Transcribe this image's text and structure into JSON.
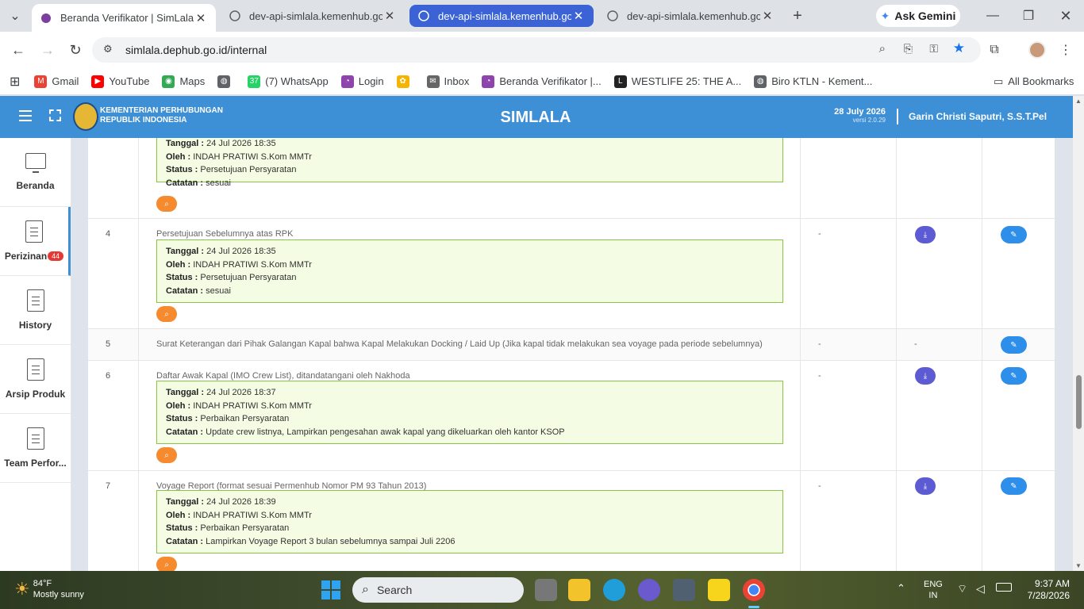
{
  "browser": {
    "tabs": [
      {
        "title": "Beranda Verifikator | SimLala",
        "active": true
      },
      {
        "title": "dev-api-simlala.kemenhub.go.id",
        "active": false
      },
      {
        "title": "dev-api-simlala.kemenhub.go.id",
        "active": false,
        "highlighted": true
      },
      {
        "title": "dev-api-simlala.kemenhub.go.id",
        "active": false
      }
    ],
    "new_tab": "+",
    "ask_gemini": "Ask Gemini",
    "url": "simlala.dephub.go.id/internal",
    "bookmarks": [
      {
        "label": "Gmail",
        "color": "#ea4335",
        "glyph": "M"
      },
      {
        "label": "YouTube",
        "color": "#ff0000",
        "glyph": "▶"
      },
      {
        "label": "Maps",
        "color": "#34a853",
        "glyph": "◉"
      },
      {
        "label": "",
        "color": "#5f6368",
        "glyph": "◍"
      },
      {
        "label": "(7) WhatsApp",
        "color": "#25d366",
        "glyph": "37"
      },
      {
        "label": "Login",
        "color": "#8e44ad",
        "glyph": "◔"
      },
      {
        "label": "",
        "color": "#f4b400",
        "glyph": "✿"
      },
      {
        "label": "Inbox",
        "color": "#666",
        "glyph": "✉"
      },
      {
        "label": "Beranda Verifikator |...",
        "color": "#8e44ad",
        "glyph": "◔"
      },
      {
        "label": "WESTLIFE 25: THE A...",
        "color": "#222",
        "glyph": "L"
      },
      {
        "label": "Biro KTLN - Kement...",
        "color": "#5f6368",
        "glyph": "◍"
      }
    ],
    "all_bookmarks": "All Bookmarks"
  },
  "app": {
    "ministry_line1": "KEMENTERIAN PERHUBUNGAN",
    "ministry_line2": "REPUBLIK INDONESIA",
    "name": "SIMLALA",
    "date": "28 July 2026",
    "version": "versi 2.0.29",
    "user": "Garin Christi Saputri, S.S.T.Pel"
  },
  "sidebar": {
    "items": [
      {
        "label": "Beranda",
        "icon": "monitor-icon"
      },
      {
        "label": "Perizinan",
        "icon": "document-icon",
        "badge": "44",
        "active": true
      },
      {
        "label": "History",
        "icon": "document-icon"
      },
      {
        "label": "Arsip Produk",
        "icon": "document-icon"
      },
      {
        "label": "Team Perfor...",
        "icon": "document-icon"
      }
    ]
  },
  "labels": {
    "tanggal": "Tanggal :",
    "oleh": "Oleh :",
    "status": "Status :",
    "catatan": "Catatan :"
  },
  "rows": [
    {
      "no": "",
      "title": "",
      "tanggal": "24 Jul 2026 18:35",
      "oleh": "INDAH PRATIWI S.Kom MMTr",
      "status": "Persetujuan Persyaratan",
      "catatan": "sesuai",
      "col3": "",
      "col4": ""
    },
    {
      "no": "4",
      "title": "Persetujuan Sebelumnya atas RPK",
      "tanggal": "24 Jul 2026 18:35",
      "oleh": "INDAH PRATIWI S.Kom MMTr",
      "status": "Persetujuan Persyaratan",
      "catatan": "sesuai",
      "col3": "-"
    },
    {
      "no": "5",
      "title": "Surat Keterangan dari Pihak Galangan Kapal bahwa Kapal Melakukan Docking / Laid Up (Jika kapal tidak melakukan sea voyage pada periode sebelumnya)",
      "col3": "-",
      "col4": "-"
    },
    {
      "no": "6",
      "title": "Daftar Awak Kapal (IMO Crew List), ditandatangani oleh Nakhoda",
      "tanggal": "24 Jul 2026 18:37",
      "oleh": "INDAH PRATIWI S.Kom MMTr",
      "status": "Perbaikan Persyaratan",
      "catatan": "Update crew listnya, Lampirkan pengesahan awak kapal yang dikeluarkan oleh kantor KSOP",
      "col3": "-"
    },
    {
      "no": "7",
      "title": "Voyage Report (format sesuai Permenhub Nomor PM 93 Tahun 2013)",
      "tanggal": "24 Jul 2026 18:39",
      "oleh": "INDAH PRATIWI S.Kom MMTr",
      "status": "Perbaikan Persyaratan",
      "catatan": "Lampirkan Voyage Report 3 bulan sebelumnya sampai Juli 2206",
      "col3": "-"
    }
  ],
  "taskbar": {
    "weather_temp": "84°F",
    "weather_desc": "Mostly sunny",
    "search": "Search",
    "lang1": "ENG",
    "lang2": "IN",
    "time": "9:37 AM",
    "date": "7/28/2026"
  }
}
